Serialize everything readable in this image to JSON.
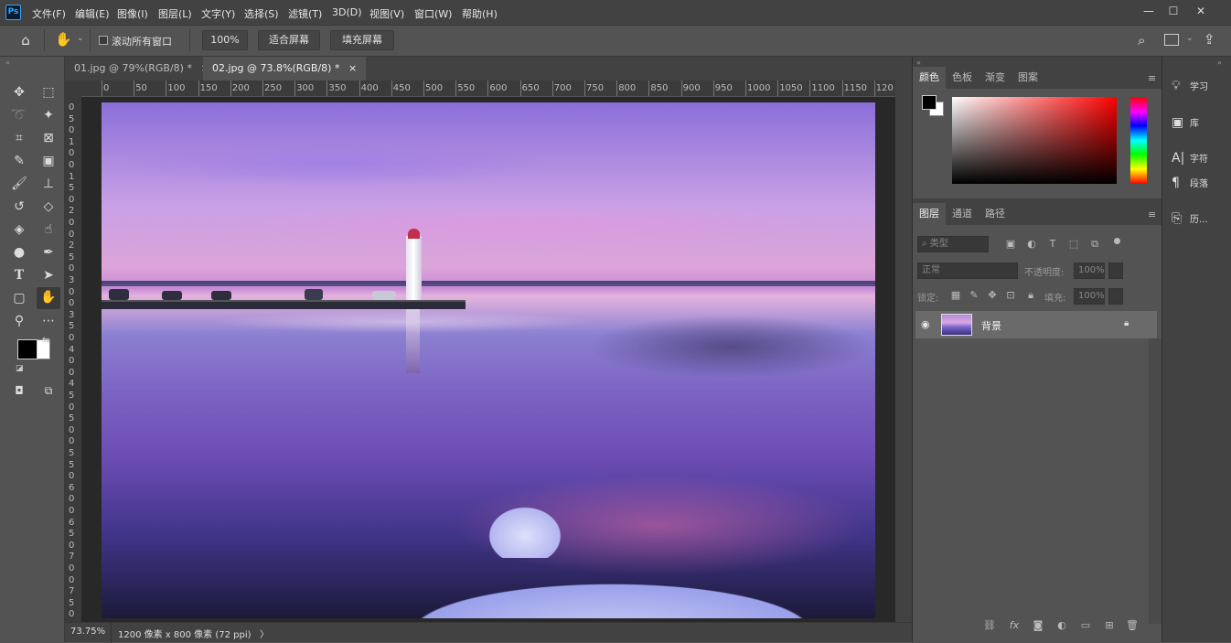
{
  "app": {
    "logo": "Ps"
  },
  "menus": [
    "文件(F)",
    "编辑(E)",
    "图像(I)",
    "图层(L)",
    "文字(Y)",
    "选择(S)",
    "滤镜(T)",
    "3D(D)",
    "视图(V)",
    "窗口(W)",
    "帮助(H)"
  ],
  "window": {
    "minimize": "—",
    "maximize": "☐",
    "close": "✕"
  },
  "options": {
    "scroll_all": "滚动所有窗口",
    "zoom": "100%",
    "fit_screen": "适合屏幕",
    "fill_screen": "填充屏幕"
  },
  "tabs": [
    {
      "label": "01.jpg @ 79%(RGB/8) *",
      "close": "×"
    },
    {
      "label": "02.jpg @ 73.8%(RGB/8) *",
      "close": "×"
    }
  ],
  "ruler": {
    "h": [
      "0",
      "50",
      "100",
      "150",
      "200",
      "250",
      "300",
      "350",
      "400",
      "450",
      "500",
      "550",
      "600",
      "650",
      "700",
      "750",
      "800",
      "850",
      "900",
      "950",
      "1000",
      "1050",
      "1100",
      "1150",
      "120"
    ],
    "v": [
      "0",
      "5",
      "0",
      "1",
      "0",
      "0",
      "1",
      "5",
      "0",
      "2",
      "0",
      "0",
      "2",
      "5",
      "0",
      "3",
      "0",
      "0",
      "3",
      "5",
      "0",
      "4",
      "0",
      "0",
      "4",
      "5",
      "0",
      "5",
      "0",
      "0",
      "5",
      "5",
      "0",
      "6",
      "0",
      "0",
      "6",
      "5",
      "0",
      "7",
      "0",
      "0",
      "7",
      "5",
      "0"
    ]
  },
  "status": {
    "zoom": "73.75%",
    "info": "1200 像素 x 800 像素 (72 ppi)",
    "arrow": "〉"
  },
  "color_panel": {
    "tabs": [
      "颜色",
      "色板",
      "渐变",
      "图案"
    ]
  },
  "layers_panel": {
    "tabs": [
      "图层",
      "通道",
      "路径"
    ],
    "filter": "类型",
    "blend": "正常",
    "opacity_label": "不透明度:",
    "opacity": "100%",
    "lock_label": "锁定:",
    "fill_label": "填充:",
    "fill": "100%",
    "layer": {
      "name": "背景"
    }
  },
  "side_panels": [
    {
      "label": "学习"
    },
    {
      "label": "库"
    },
    {
      "label": "字符"
    },
    {
      "label": "段落"
    },
    {
      "label": "历..."
    }
  ],
  "colors": {
    "accent": "#31a8ff",
    "foreground": "#000000",
    "background": "#ffffff"
  }
}
